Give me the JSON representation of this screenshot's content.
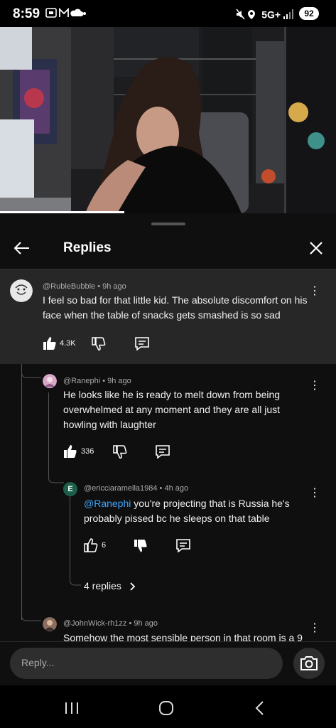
{
  "status_bar": {
    "time": "8:59",
    "network": "5G+",
    "battery": "92"
  },
  "panel": {
    "title": "Replies"
  },
  "main_comment": {
    "author": "@RubleBubble",
    "age": "9h ago",
    "text": "I feel so bad for that little kid. The absolute discomfort on his face when the table of snacks gets smashed is so sad",
    "likes": "4.3K"
  },
  "replies": [
    {
      "author": "@Ranephi",
      "age": "9h ago",
      "text": "He looks like he is ready to melt down from being overwhelmed at any moment and they are all just howling with laughter",
      "likes": "336"
    },
    {
      "author": "@ericciaramella1984",
      "age": "4h ago",
      "avatar_letter": "E",
      "mention": "@Ranephi",
      "text": " you're projecting that is Russia he's probably pissed bc he sleeps on that table",
      "likes": "6",
      "more_replies": "4 replies"
    },
    {
      "author": "@JohnWick-rh1zz",
      "age": "9h ago",
      "text": "Somehow the most sensible person in that room is a 9"
    }
  ],
  "reply_bar": {
    "placeholder": "Reply..."
  },
  "colors": {
    "background": "#0f0f0f",
    "highlight": "#272727",
    "mention": "#3ea6ff",
    "avatar_e": "#1b5e4a"
  }
}
